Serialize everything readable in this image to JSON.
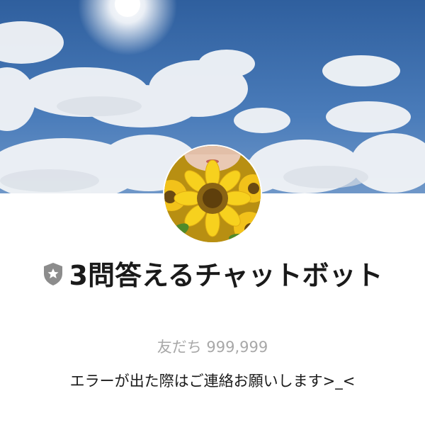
{
  "profile": {
    "name": "3問答えるチャットボット",
    "friends_label": "友だち",
    "friends_count": "999,999",
    "status_message": "エラーが出た際はご連絡お願いします>_<"
  },
  "icons": {
    "badge": "shield-star-icon"
  },
  "colors": {
    "sky": "#3a6aa8",
    "badge": "#8c8c8c",
    "name_text": "#1a1a1a",
    "friends_text": "#a8a8a8"
  }
}
